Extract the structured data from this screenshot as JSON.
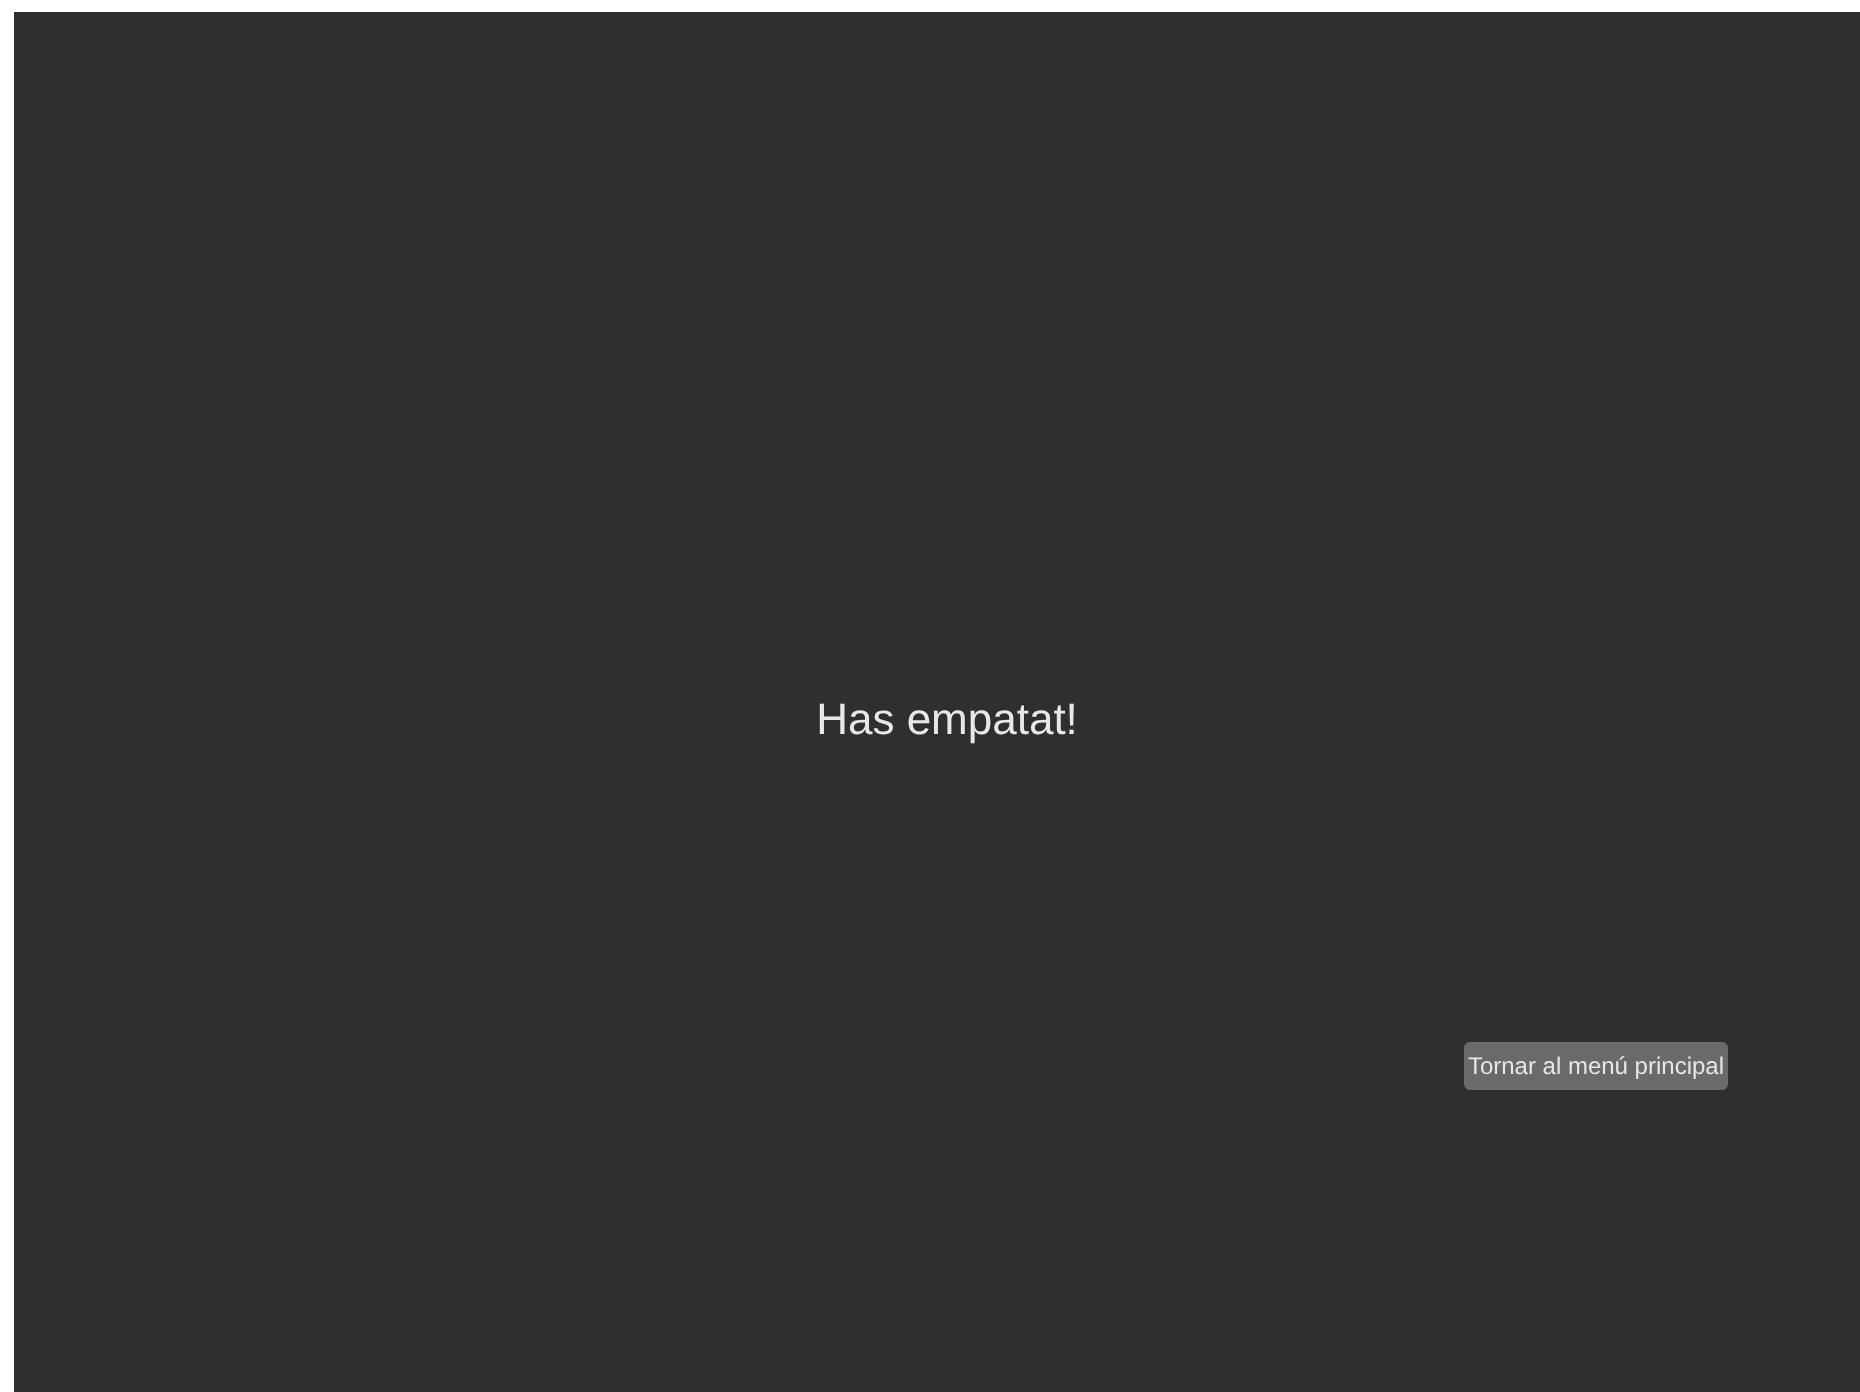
{
  "message": "Has empatat!",
  "buttons": [
    {
      "label": "Tornar al menú principal"
    }
  ]
}
